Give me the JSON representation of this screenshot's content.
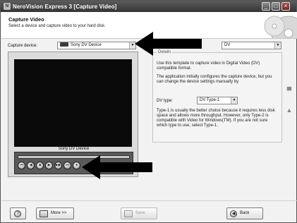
{
  "window": {
    "app_icon": "N",
    "title": "NeroVision Express 3 [Capture Video]",
    "minimize_glyph": "_",
    "maximize_glyph": "□",
    "close_glyph": "×"
  },
  "header": {
    "title": "Capture Video",
    "subtitle": "Select a device and capture video to your hard disk."
  },
  "capture_device": {
    "label": "Capture device:",
    "value": "Sony DV Device"
  },
  "format_select": {
    "value": "DV"
  },
  "preview": {
    "device_name": "Sony DV Device",
    "transport_controls": [
      "previous",
      "rewind",
      "stop",
      "play",
      "fast-forward",
      "next",
      "record"
    ],
    "control_glyphs": [
      "⏮",
      "◀",
      "■",
      "▶",
      "▶▶",
      "⏭",
      "●"
    ]
  },
  "details": {
    "legend": "Details",
    "intro": "Use this template to capture video in Digital Video (DV) compatible format.",
    "config_note": "The application initially configures the capture device, but you can change the device settings manually by",
    "dv_type_label": "DV type:",
    "dv_type_value": "DV Type-1",
    "type_note": "Type-1 is usually the better choice because it requires less disk space and allows more throughput. However, only Type-2 is compatible with Video for Windows(TM). If you are not sure which type to use, select Type-1."
  },
  "side_icons": [
    "save-preset-icon",
    "delete-preset-icon"
  ],
  "footer": {
    "help_glyph": "?",
    "more_label": "More >>",
    "save_label": "Save",
    "back_label": "Back"
  }
}
